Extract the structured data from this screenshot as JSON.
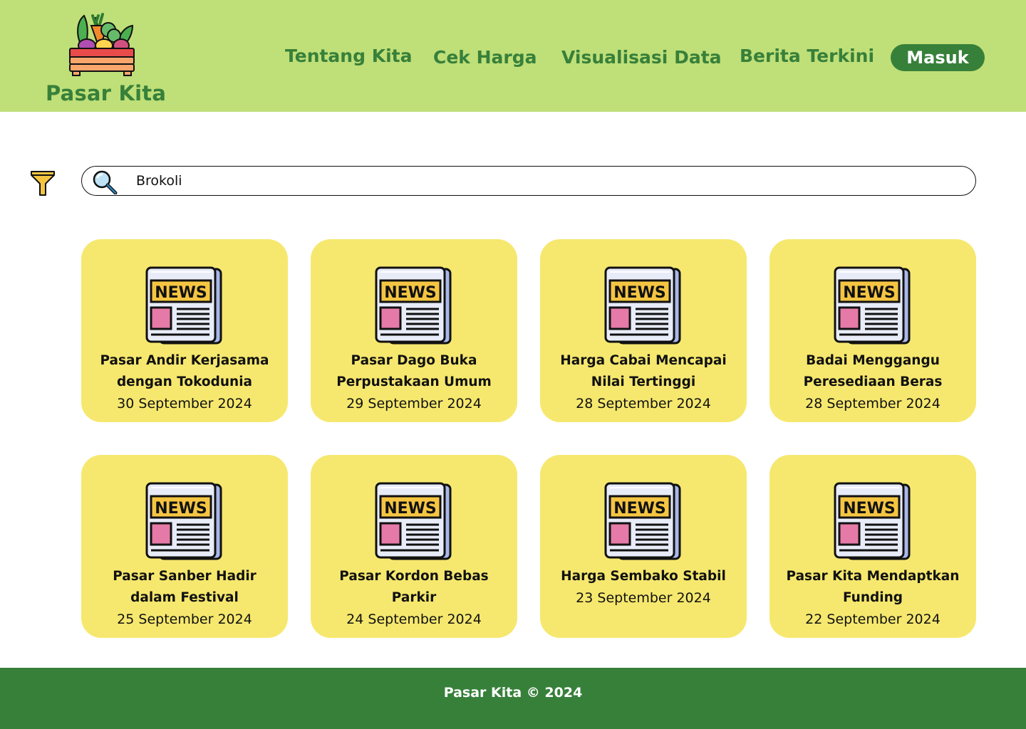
{
  "brand": {
    "name": "Pasar Kita",
    "logo_icon": "vegetable-crate-icon"
  },
  "nav": {
    "items": [
      {
        "label": "Tentang Kita"
      },
      {
        "label": "Cek Harga"
      },
      {
        "label": "Visualisasi Data"
      },
      {
        "label": "Berita Terkini"
      }
    ],
    "login_label": "Masuk"
  },
  "search": {
    "value": "Brokoli",
    "filter_icon": "funnel-icon",
    "search_icon": "magnifier-icon"
  },
  "news": {
    "icon": "newspaper-icon",
    "icon_text": "NEWS",
    "items": [
      {
        "title": "Pasar Andir Kerjasama dengan Tokodunia",
        "date": "30 September 2024"
      },
      {
        "title": "Pasar Dago Buka Perpustakaan Umum",
        "date": "29 September 2024"
      },
      {
        "title": "Harga Cabai Mencapai Nilai Tertinggi",
        "date": "28 September 2024"
      },
      {
        "title": "Badai Menggangu Peresediaan Beras",
        "date": "28 September 2024"
      },
      {
        "title": "Pasar Sanber Hadir dalam Festival",
        "date": "25 September 2024"
      },
      {
        "title": "Pasar Kordon Bebas Parkir",
        "date": "24 September 2024"
      },
      {
        "title": "Harga Sembako Stabil",
        "date": "23 September 2024"
      },
      {
        "title": "Pasar Kita Mendaptkan Funding",
        "date": "22 September 2024"
      }
    ]
  },
  "footer": {
    "text": "Pasar Kita © 2024"
  },
  "colors": {
    "header_bg": "#bfdf78",
    "brand_green": "#37803a",
    "card_bg": "#f6e86e",
    "footer_bg": "#37803a"
  }
}
